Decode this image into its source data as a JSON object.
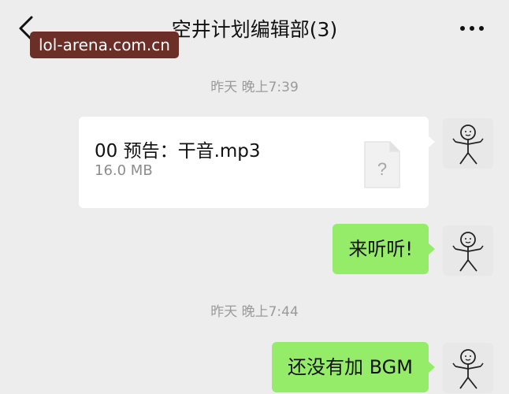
{
  "header": {
    "title": "空井计划编辑部(3)",
    "back_icon": "back-chevron-icon",
    "more_icon": "more-dots-icon"
  },
  "watermark": "lol-arena.com.cn",
  "messages": [
    {
      "type": "timestamp",
      "text": "昨天 晚上7:39"
    },
    {
      "type": "file",
      "name": "00 预告：干音.mp3",
      "size": "16.0 MB",
      "icon": "unknown-file-icon"
    },
    {
      "type": "text",
      "text": "来听听!"
    },
    {
      "type": "timestamp",
      "text": "昨天 晚上7:44"
    },
    {
      "type": "text",
      "text": "还没有加 BGM"
    }
  ],
  "colors": {
    "background": "#ededed",
    "sent_bubble": "#95ec69",
    "file_card": "#ffffff",
    "watermark_bg": "#6b2f28"
  }
}
